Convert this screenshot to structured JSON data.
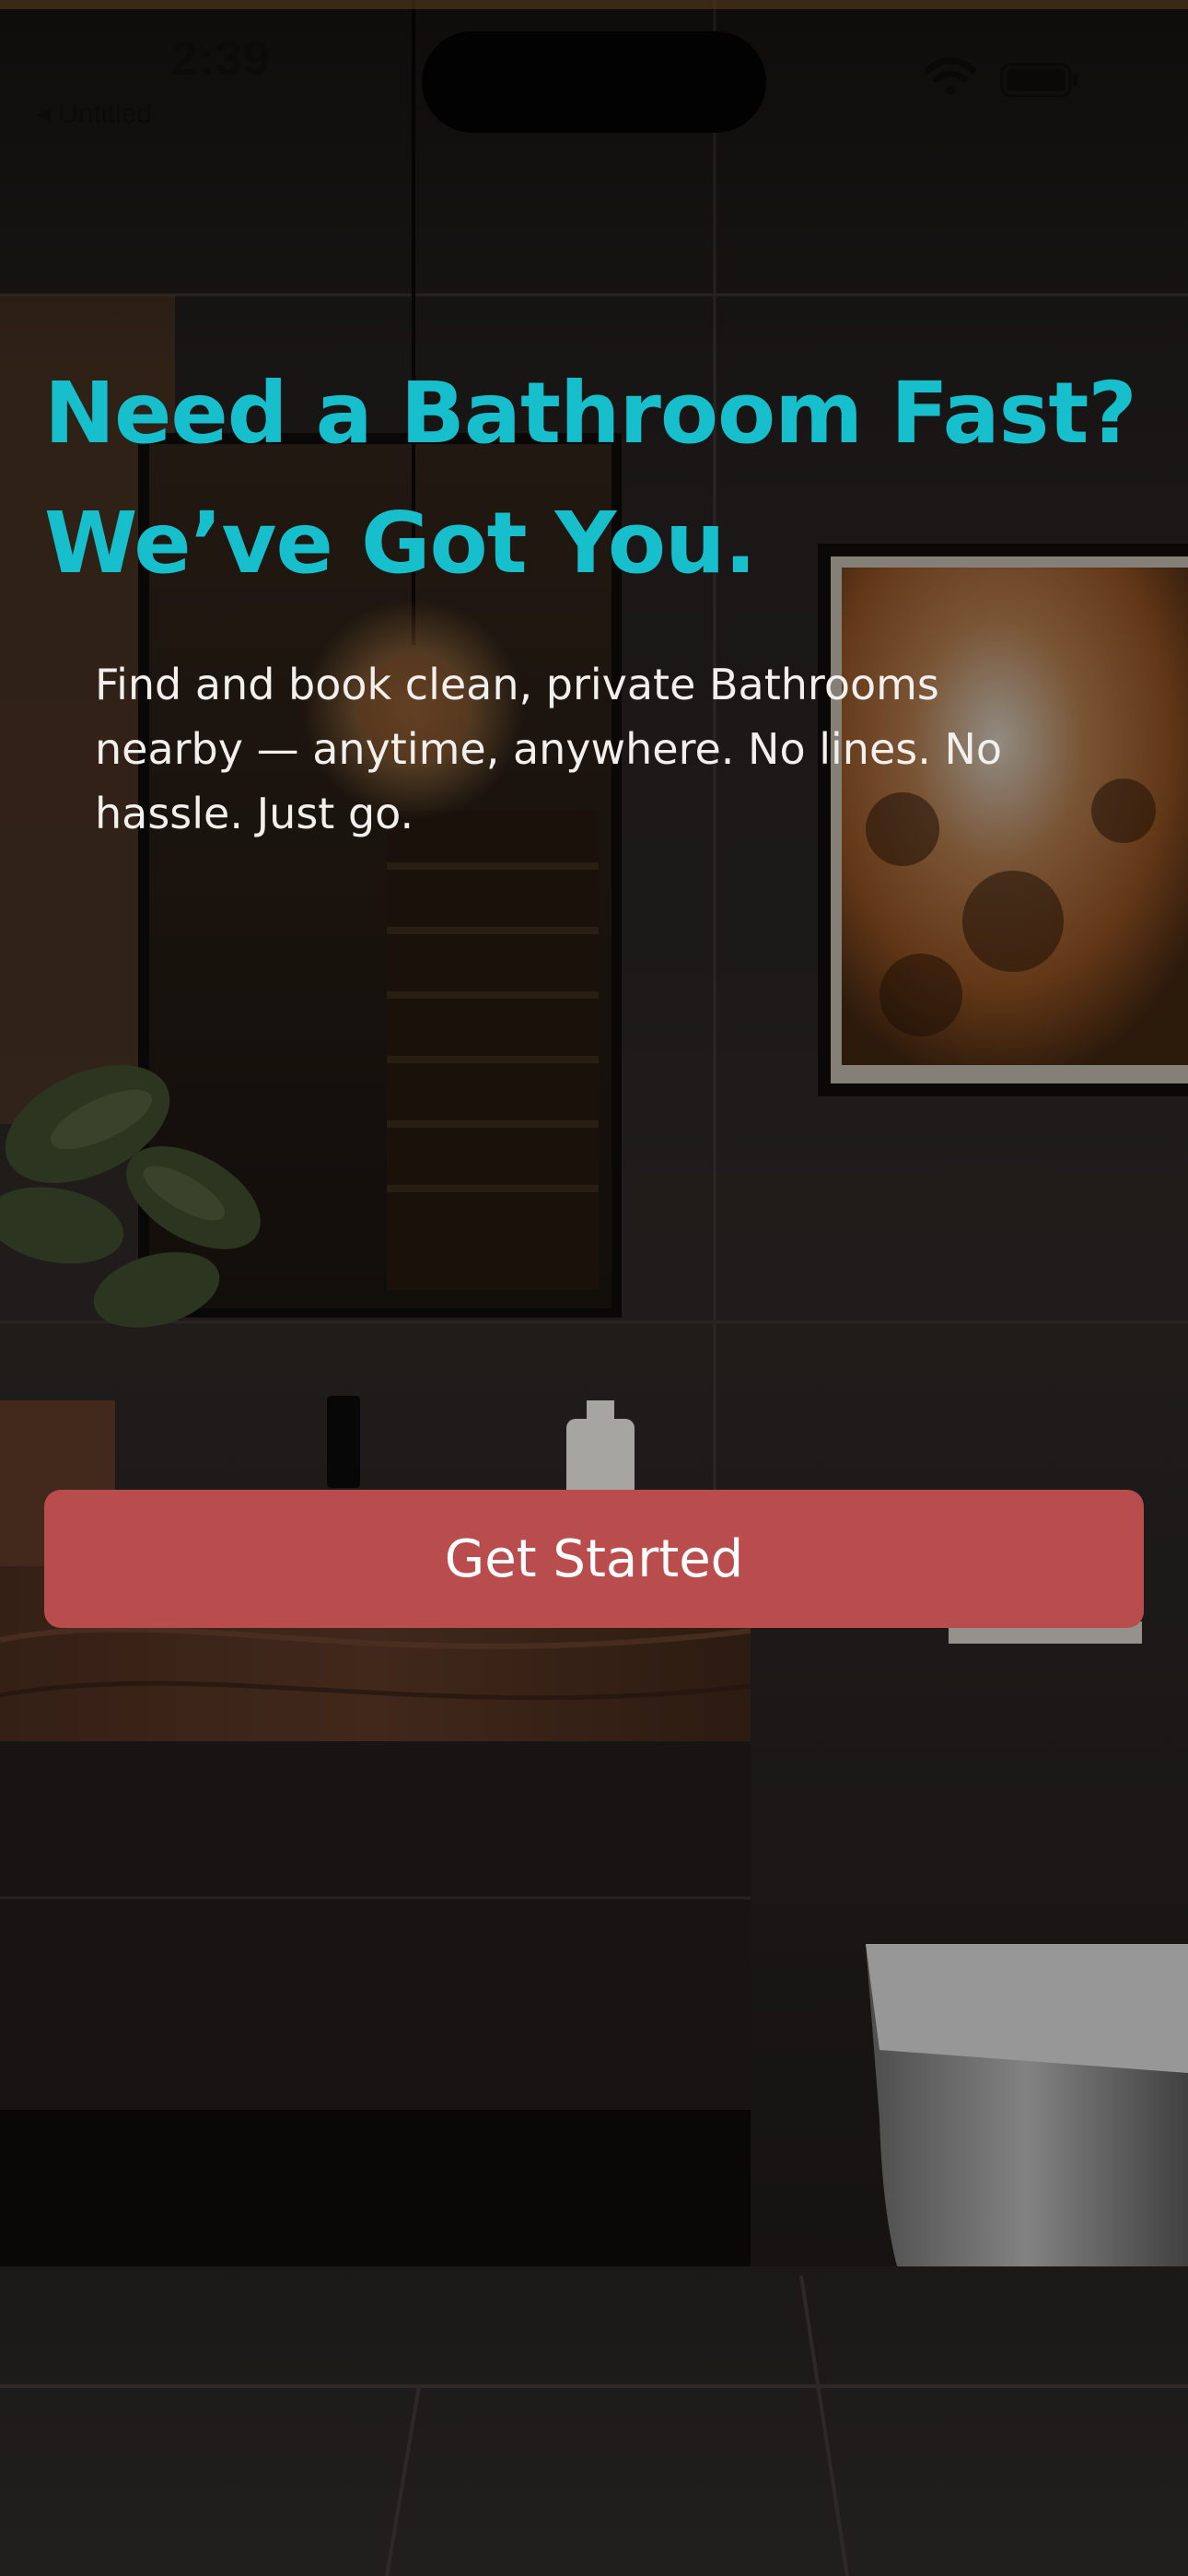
{
  "status_bar": {
    "time": "2:39",
    "back_label": "◂ Untitled"
  },
  "hero": {
    "headline_line1": "Need a Bathroom Fast?",
    "headline_line2": "We’ve Got You.",
    "subtitle": "Find and book clean, private Bathrooms nearby — anytime, anywhere. No lines. No hassle. Just go."
  },
  "cta": {
    "label": "Get Started"
  },
  "colors": {
    "headline": "#16bfcb",
    "cta_background": "#b94d4d",
    "subtitle_text": "#f2efec"
  },
  "icons": [
    "wifi-icon",
    "battery-icon"
  ]
}
